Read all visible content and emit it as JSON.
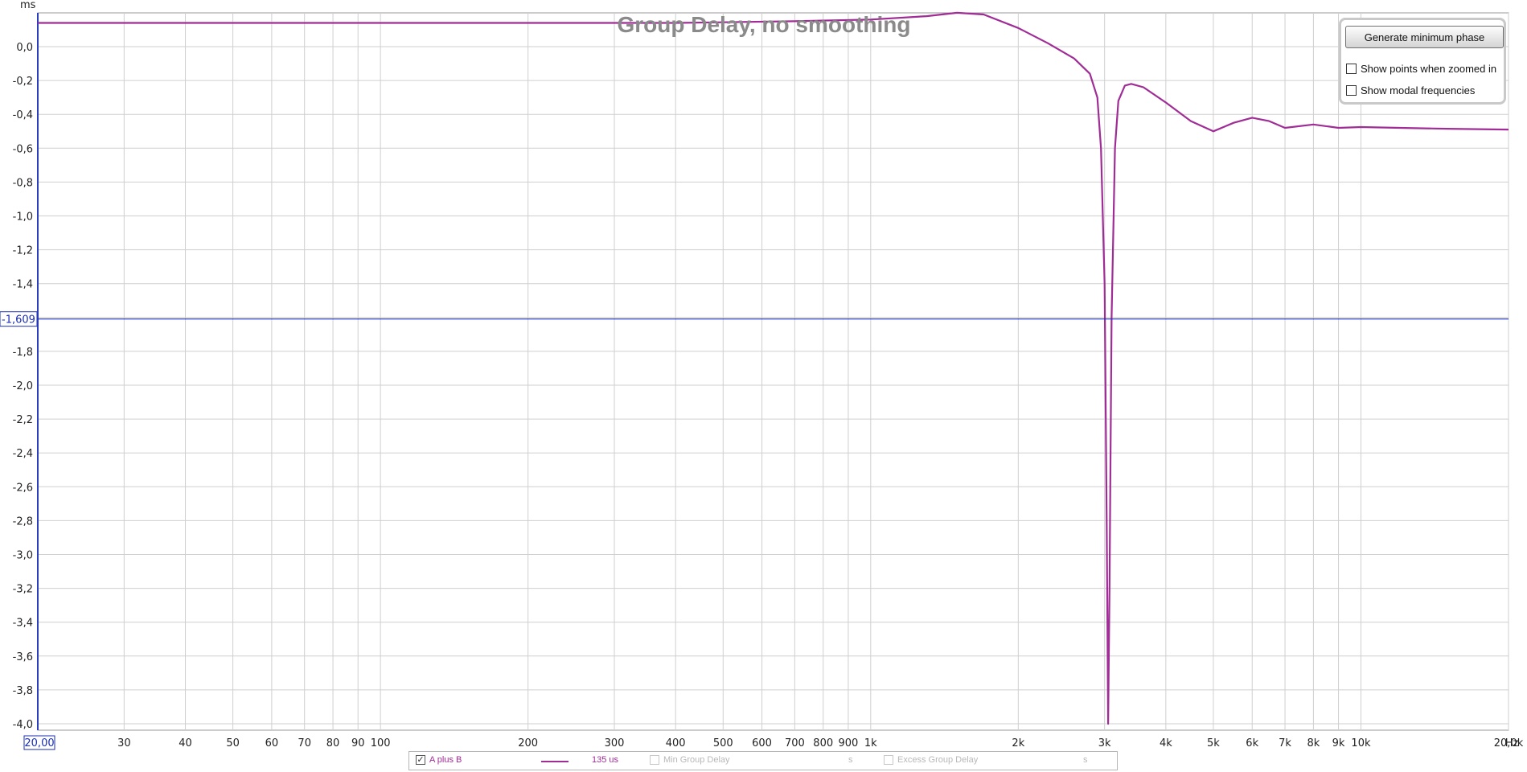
{
  "chart_data": {
    "type": "line",
    "title": "Group Delay, no smoothing",
    "ylabel": "ms",
    "xunit": "Hz",
    "xscale": "log",
    "xlim": [
      20,
      20000
    ],
    "ylim": [
      -4.0,
      0.2
    ],
    "grid": true,
    "y_ticks": [
      "0,0",
      "-0,2",
      "-0,4",
      "-0,6",
      "-0,8",
      "-1,0",
      "-1,2",
      "-1,4",
      "-1,6",
      "-1,8",
      "-2,0",
      "-2,2",
      "-2,4",
      "-2,6",
      "-2,8",
      "-3,0",
      "-3,2",
      "-3,4",
      "-3,6",
      "-3,8",
      "-4,0"
    ],
    "x_ticks": [
      {
        "v": 20,
        "label": "20,00"
      },
      {
        "v": 30,
        "label": "30"
      },
      {
        "v": 40,
        "label": "40"
      },
      {
        "v": 50,
        "label": "50"
      },
      {
        "v": 60,
        "label": "60"
      },
      {
        "v": 70,
        "label": "70"
      },
      {
        "v": 80,
        "label": "80"
      },
      {
        "v": 90,
        "label": "90"
      },
      {
        "v": 100,
        "label": "100"
      },
      {
        "v": 200,
        "label": "200"
      },
      {
        "v": 300,
        "label": "300"
      },
      {
        "v": 400,
        "label": "400"
      },
      {
        "v": 500,
        "label": "500"
      },
      {
        "v": 600,
        "label": "600"
      },
      {
        "v": 700,
        "label": "700"
      },
      {
        "v": 800,
        "label": "800"
      },
      {
        "v": 900,
        "label": "900"
      },
      {
        "v": 1000,
        "label": "1k"
      },
      {
        "v": 2000,
        "label": "2k"
      },
      {
        "v": 3000,
        "label": "3k"
      },
      {
        "v": 4000,
        "label": "4k"
      },
      {
        "v": 5000,
        "label": "5k"
      },
      {
        "v": 6000,
        "label": "6k"
      },
      {
        "v": 7000,
        "label": "7k"
      },
      {
        "v": 8000,
        "label": "8k"
      },
      {
        "v": 9000,
        "label": "9k"
      },
      {
        "v": 10000,
        "label": "10k"
      },
      {
        "v": 20000,
        "label": "20,0k"
      }
    ],
    "cursor": {
      "y": -1.609,
      "label": "-1,609"
    },
    "series": [
      {
        "name": "A plus B",
        "color": "#a02c96",
        "x": [
          20,
          50,
          100,
          200,
          400,
          700,
          1000,
          1300,
          1500,
          1700,
          2000,
          2300,
          2600,
          2800,
          2900,
          2950,
          3000,
          3030,
          3050,
          3070,
          3100,
          3150,
          3200,
          3300,
          3400,
          3600,
          4000,
          4500,
          5000,
          5500,
          6000,
          6500,
          7000,
          8000,
          9000,
          10000,
          12000,
          15000,
          20000
        ],
        "y": [
          0.14,
          0.14,
          0.14,
          0.14,
          0.14,
          0.15,
          0.16,
          0.18,
          0.2,
          0.19,
          0.11,
          0.02,
          -0.07,
          -0.16,
          -0.3,
          -0.6,
          -1.4,
          -2.8,
          -4.0,
          -3.2,
          -1.6,
          -0.6,
          -0.32,
          -0.23,
          -0.22,
          -0.24,
          -0.33,
          -0.44,
          -0.5,
          -0.45,
          -0.42,
          -0.44,
          -0.48,
          -0.46,
          -0.48,
          -0.475,
          -0.48,
          -0.485,
          -0.49
        ]
      }
    ]
  },
  "controls": {
    "min_phase_button": "Generate minimum phase",
    "show_points_label": "Show points when zoomed in",
    "show_modal_label": "Show modal frequencies"
  },
  "legend": {
    "a_plus_b": {
      "label": "A plus B",
      "value": "135 us",
      "color": "#a02c96"
    },
    "min_group_delay": {
      "label": "Min Group Delay",
      "value": "s"
    },
    "excess_group_delay": {
      "label": "Excess Group Delay",
      "value": "s"
    }
  }
}
